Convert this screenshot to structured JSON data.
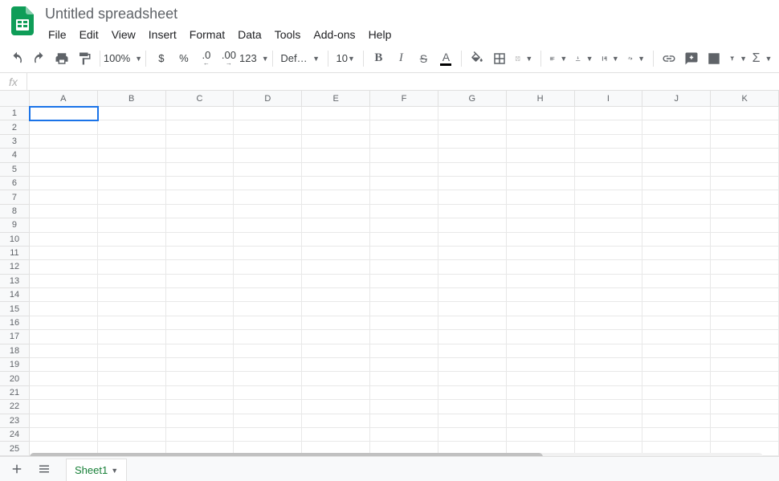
{
  "document": {
    "title": "Untitled spreadsheet"
  },
  "menus": [
    "File",
    "Edit",
    "View",
    "Insert",
    "Format",
    "Data",
    "Tools",
    "Add-ons",
    "Help"
  ],
  "toolbar": {
    "zoom": "100%",
    "currency": "$",
    "percent": "%",
    "dec_less": ".0",
    "dec_more": ".00",
    "more_formats": "123",
    "font": "Default (Ari...",
    "font_size": "10"
  },
  "formula_bar": {
    "fx": "fx",
    "value": ""
  },
  "columns": [
    "A",
    "B",
    "C",
    "D",
    "E",
    "F",
    "G",
    "H",
    "I",
    "J",
    "K"
  ],
  "rows": [
    "1",
    "2",
    "3",
    "4",
    "5",
    "6",
    "7",
    "8",
    "9",
    "10",
    "11",
    "12",
    "13",
    "14",
    "15",
    "16",
    "17",
    "18",
    "19",
    "20",
    "21",
    "22",
    "23",
    "24",
    "25"
  ],
  "selected_cell": "A1",
  "sheet": {
    "active": "Sheet1"
  }
}
